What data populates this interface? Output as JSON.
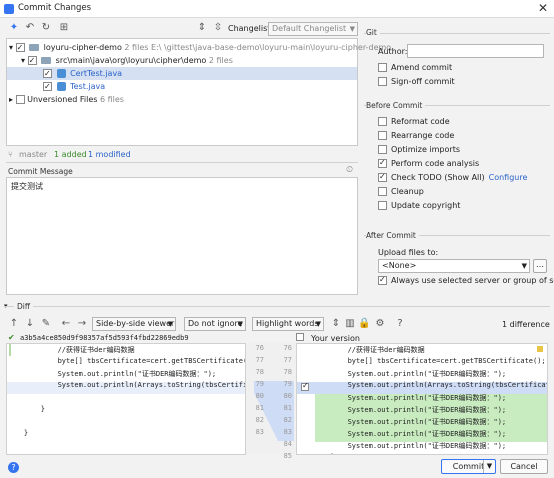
{
  "window": {
    "title": "Commit Changes"
  },
  "toolbar": {
    "changelist_label": "Changelist:",
    "changelist_value": "Default Changelist"
  },
  "tree": {
    "root": {
      "name": "loyuru-cipher-demo",
      "count": "2 files",
      "path": "E:\\      \\gittest\\java-base-demo\\loyuru-main\\loyuru-cipher-demo"
    },
    "package": {
      "name": "src\\main\\java\\org\\loyuru\\cipher\\demo",
      "count": "2 files"
    },
    "files": [
      "CertTest.java",
      "Test.java"
    ],
    "unversioned": {
      "name": "Unversioned Files",
      "count": "6 files"
    }
  },
  "status": {
    "branch": "master",
    "added": "1 added",
    "modified": "1 modified"
  },
  "commit_message": {
    "label": "Commit Message",
    "text": "提交测试"
  },
  "git": {
    "header": "Git",
    "author_label": "Author:",
    "amend": "Amend commit",
    "signoff": "Sign-off commit"
  },
  "before_commit": {
    "header": "Before Commit",
    "items": [
      {
        "label": "Reformat code",
        "checked": false
      },
      {
        "label": "Rearrange code",
        "checked": false
      },
      {
        "label": "Optimize imports",
        "checked": false
      },
      {
        "label": "Perform code analysis",
        "checked": true
      },
      {
        "label": "Check TODO (Show All)",
        "checked": true,
        "link": "Configure"
      },
      {
        "label": "Cleanup",
        "checked": false
      },
      {
        "label": "Update copyright",
        "checked": false
      }
    ]
  },
  "after_commit": {
    "header": "After Commit",
    "upload_label": "Upload files to:",
    "upload_value": "<None>",
    "always_use": "Always use selected server or group of servers"
  },
  "diff": {
    "header": "Diff",
    "viewer": "Side-by-side viewer",
    "ignore": "Do not ignore",
    "highlight": "Highlight words",
    "diff_count": "1 difference",
    "hash": "a3b5a4ce850d9f98357af5d593f4fbd22869edb9",
    "your_version": "Your version",
    "left_lines": [
      {
        "n": "76",
        "text": "            //获得证书der编码数据"
      },
      {
        "n": "77",
        "text": "            byte[] tbsCertificate=cert.getTBSCertificate();"
      },
      {
        "n": "78",
        "text": "            System.out.println(\"证书DER编码数据：\");"
      },
      {
        "n": "79",
        "text": "            System.out.println(Arrays.toString(tbsCertificate))"
      },
      {
        "n": "80",
        "text": ""
      },
      {
        "n": "81",
        "text": "        }"
      },
      {
        "n": "82",
        "text": ""
      },
      {
        "n": "83",
        "text": "    }"
      }
    ],
    "right_lines": [
      {
        "n": "76",
        "text": "            //获得证书der编码数据"
      },
      {
        "n": "77",
        "text": "            byte[] tbsCertificate=cert.getTBSCertificate();"
      },
      {
        "n": "78",
        "text": "            System.out.println(\"证书DER编码数据：\");"
      },
      {
        "n": "79",
        "text": "            System.out.println(Arrays.toString(tbsCertificate));"
      },
      {
        "n": "80",
        "text": "            System.out.println(\"证书DER编码数据：\");"
      },
      {
        "n": "81",
        "text": "            System.out.println(\"证书DER编码数据：\");"
      },
      {
        "n": "82",
        "text": "            System.out.println(\"证书DER编码数据：\");"
      },
      {
        "n": "83",
        "text": "            System.out.println(\"证书DER编码数据：\");"
      },
      {
        "n": "84",
        "text": "            System.out.println(\"证书DER编码数据：\");"
      },
      {
        "n": "85",
        "text": "        }"
      }
    ]
  },
  "buttons": {
    "commit": "Commit",
    "cancel": "Cancel"
  },
  "colors": {
    "added_green": "#c8ecc0",
    "modified_blue": "#cfdcf5",
    "link": "#2a62c9"
  }
}
